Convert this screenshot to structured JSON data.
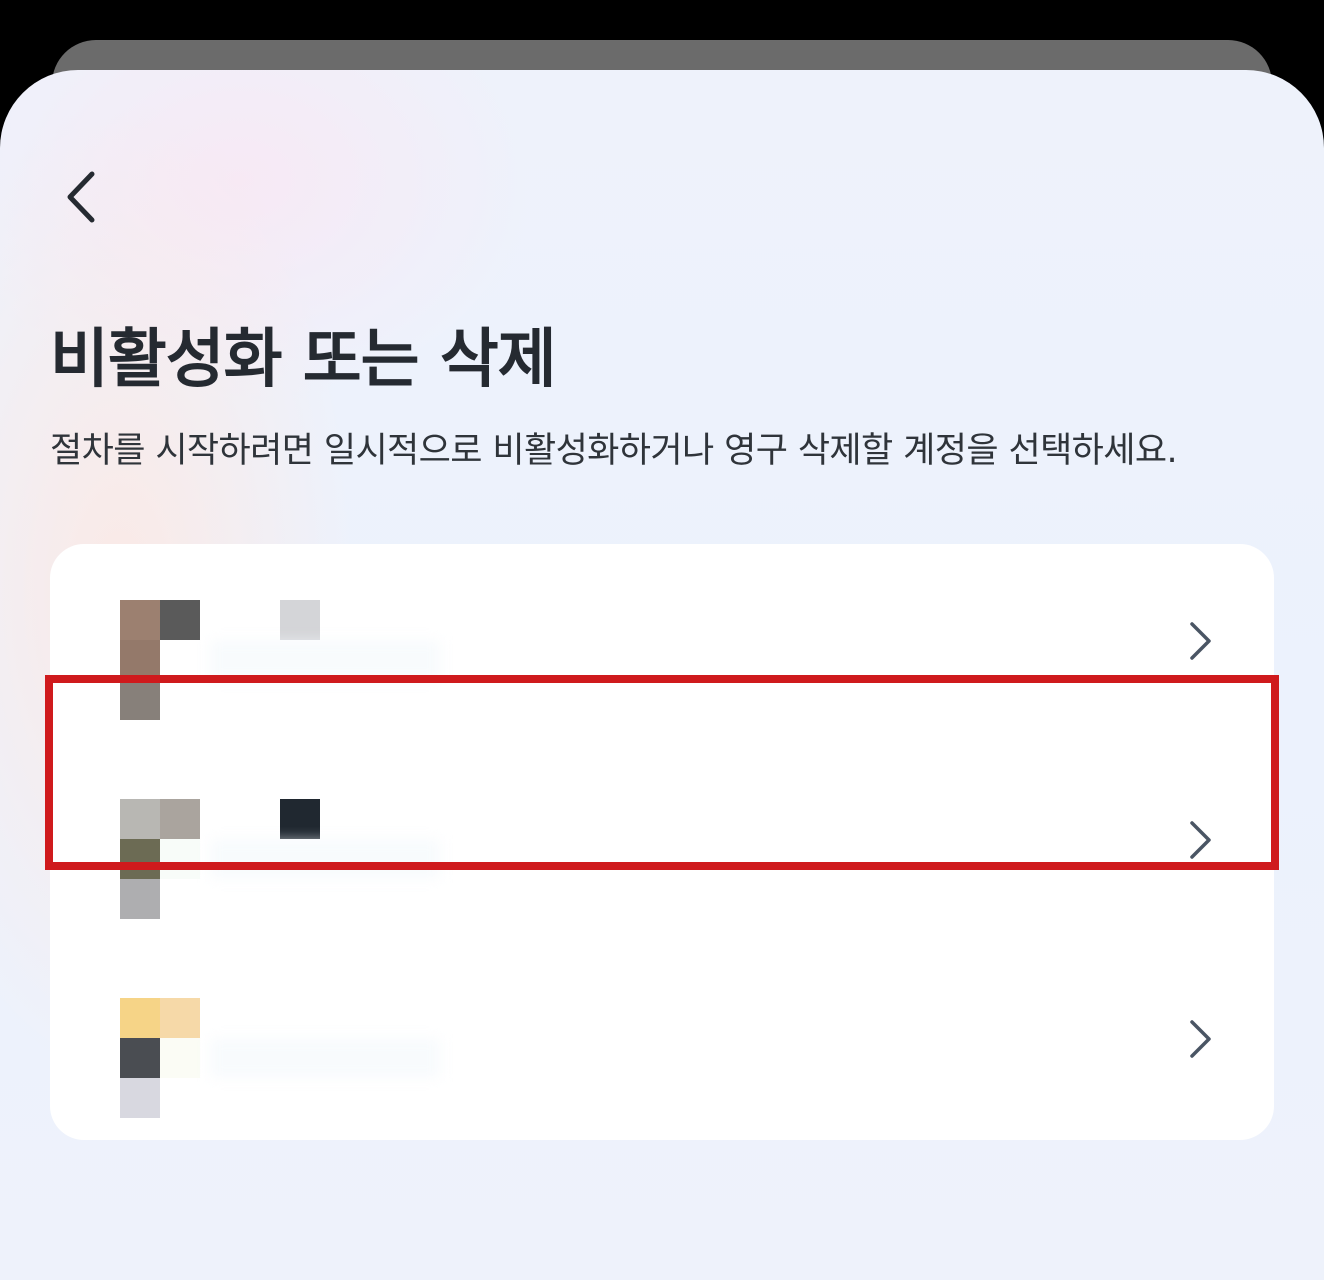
{
  "header": {
    "back_icon": "chevron-left-icon"
  },
  "page": {
    "title": "비활성화 또는 삭제",
    "description": "절차를 시작하려면 일시적으로 비활성화하거나 영구 삭제할 계정을 선택하세요."
  },
  "accounts": [
    {
      "avatar_colors": [
        "#9c8070",
        "#5a5a5a",
        "#94796a",
        "#ffffff",
        "#87807a"
      ],
      "name_color": "#d4d5d8",
      "chevron_icon": "chevron-right-icon"
    },
    {
      "avatar_colors": [
        "#b8b7b3",
        "#aaa49e",
        "#6c6b54",
        "#f8fcf9",
        "#aeaeb0"
      ],
      "name_color": "#202830",
      "chevron_icon": "chevron-right-icon",
      "highlighted": true
    },
    {
      "avatar_colors": [
        "#f6d487",
        "#f6d9a8",
        "#4a4d52",
        "#fbfcf5",
        "#d8d8e0"
      ],
      "name_color": "#ffffff",
      "chevron_icon": "chevron-right-icon"
    }
  ],
  "colors": {
    "highlight": "#cf1a1d",
    "title": "#252a31",
    "chevron": "#4a5564"
  }
}
